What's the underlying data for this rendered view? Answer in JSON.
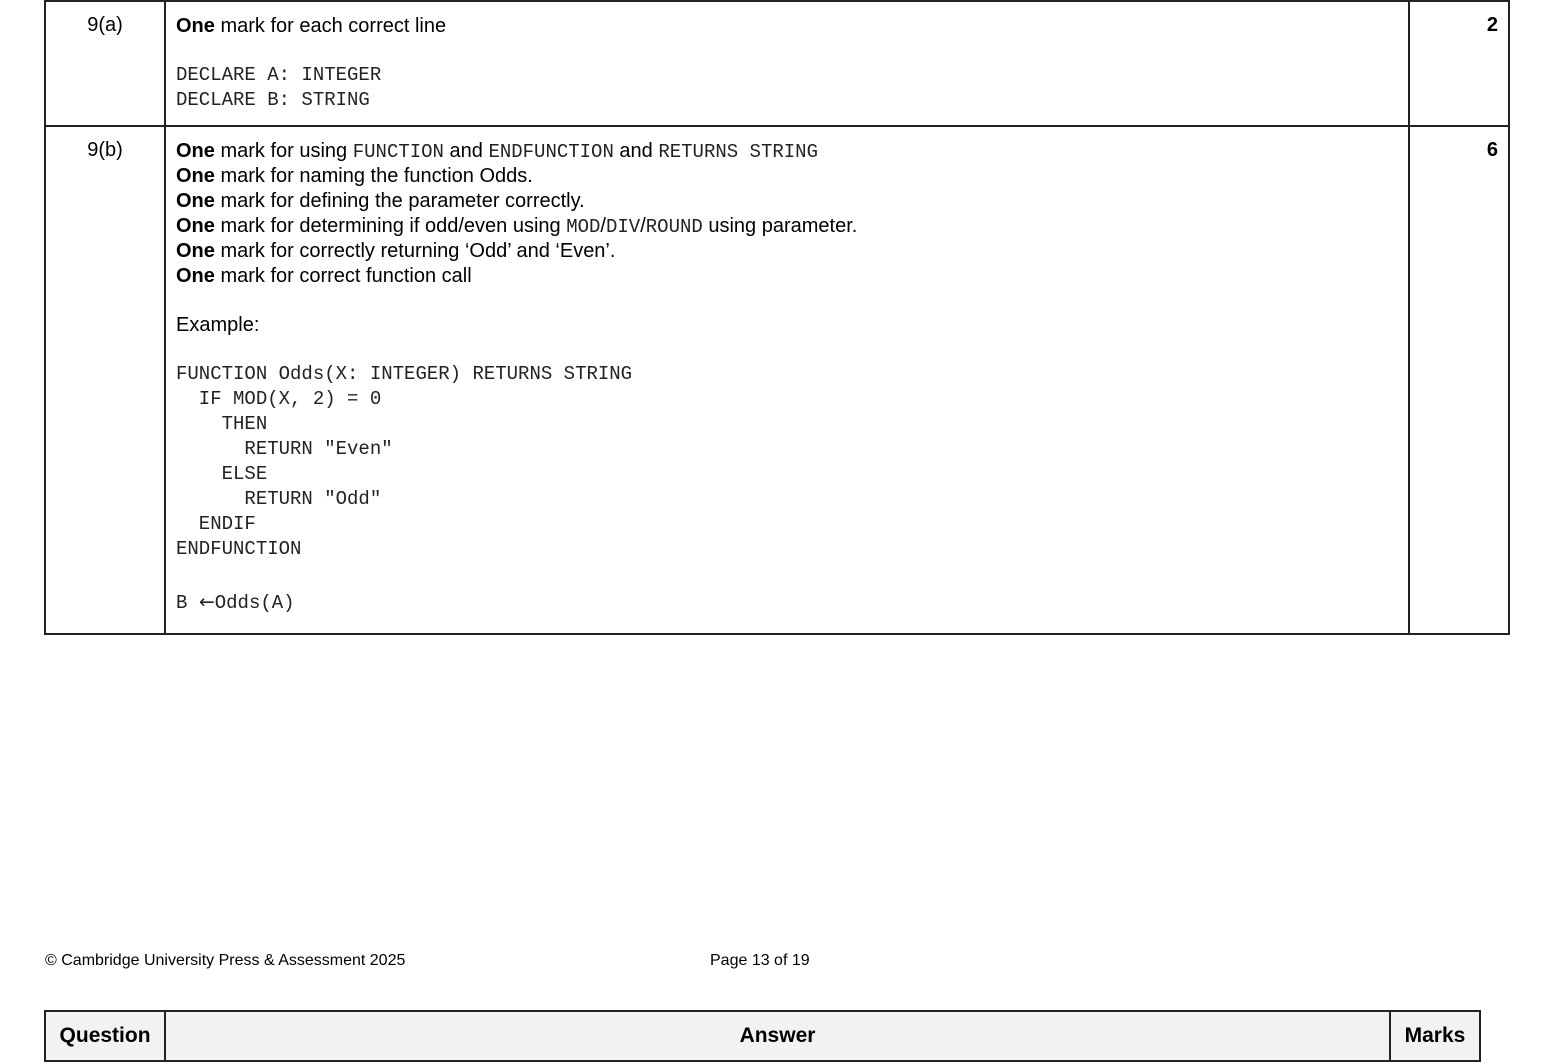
{
  "rows": [
    {
      "question": "9(a)",
      "marks": "2",
      "criteria": [
        {
          "bold": "One",
          "text": " mark for each correct line"
        }
      ],
      "code": [
        "DECLARE A: INTEGER",
        "DECLARE B: STRING"
      ]
    },
    {
      "question": "9(b)",
      "marks": "6",
      "criterion1": {
        "bold": "One",
        "t1": " mark for using ",
        "c1": "FUNCTION",
        "t2": " and ",
        "c2": "ENDFUNCTION",
        "t3": " and ",
        "c3": "RETURNS STRING"
      },
      "criterion2": {
        "bold": "One",
        "text": " mark for naming the function Odds."
      },
      "criterion3": {
        "bold": "One",
        "text": " mark for defining the parameter correctly."
      },
      "criterion4": {
        "bold": "One",
        "t1": " mark for determining if odd/even using ",
        "c1": "MOD",
        "s1": "/",
        "c2": "DIV",
        "s2": "/",
        "c3": "ROUND",
        "t2": " using parameter."
      },
      "criterion5": {
        "bold": "One",
        "text": " mark for correctly returning ‘Odd’ and ‘Even’."
      },
      "criterion6": {
        "bold": "One",
        "text": " mark for correct function call"
      },
      "example_label": "Example:",
      "code": [
        "FUNCTION Odds(X: INTEGER) RETURNS STRING",
        "  IF MOD(X, 2) = 0",
        "    THEN",
        "      RETURN \"Even\"",
        "    ELSE",
        "      RETURN \"Odd\"",
        "  ENDIF",
        "ENDFUNCTION"
      ],
      "call_line": {
        "lhs": "B ",
        "arrow": "←",
        "rhs": "Odds(A)"
      }
    }
  ],
  "footer": {
    "copyright": "© Cambridge University Press & Assessment 2025",
    "page": "Page 13 of 19"
  },
  "header": {
    "question": "Question",
    "answer": "Answer",
    "marks": "Marks"
  }
}
